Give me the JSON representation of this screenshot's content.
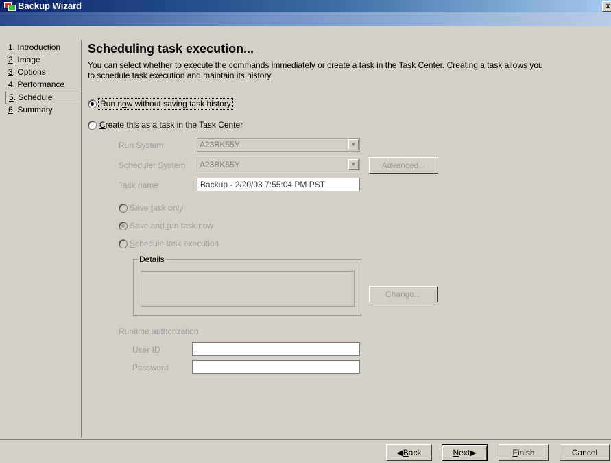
{
  "window": {
    "title": "Backup Wizard",
    "close_glyph": "x"
  },
  "nav": {
    "items": [
      {
        "num": "1",
        "rest": ". Introduction"
      },
      {
        "num": "2",
        "rest": ". Image"
      },
      {
        "num": "3",
        "rest": ". Options"
      },
      {
        "num": "4",
        "rest": ". Performance"
      },
      {
        "num": "5",
        "rest": ". Schedule"
      },
      {
        "num": "6",
        "rest": ". Summary"
      }
    ]
  },
  "page": {
    "heading": "Scheduling task execution...",
    "desc_line1": "You can select whether to execute the commands immediately or create a task in the Task Center. Creating a task allows you",
    "desc_line2": "to schedule task execution and maintain its history."
  },
  "options": {
    "run_now_prefix": "Run n",
    "run_now_accel": "o",
    "run_now_suffix": "w without saving task history",
    "create_accel": "C",
    "create_suffix": "reate this as a task in the Task Center"
  },
  "form": {
    "run_system_label": "Run System",
    "run_system_value": "A23BK55Y",
    "scheduler_system_label": "Scheduler System",
    "scheduler_system_value": "A23BK55Y",
    "advanced_accel": "A",
    "advanced_suffix": "dvanced...",
    "task_name_label": "Task name",
    "task_name_value": "Backup - 2/20/03 7:55:04 PM PST",
    "save_only_prefix": "Save ",
    "save_only_accel": "t",
    "save_only_suffix": "ask only",
    "save_run_prefix": "Save and ",
    "save_run_accel": "r",
    "save_run_suffix": "un task now",
    "schedule_accel": "S",
    "schedule_suffix": "chedule task execution",
    "details_label": "Details",
    "change_label": "Change...",
    "runtime_auth_label": "Runtime authorization",
    "user_id_label": "User ID",
    "user_id_value": "",
    "password_label": "Password",
    "password_value": ""
  },
  "footer": {
    "back_accel": "B",
    "back_suffix": "ack",
    "next_accel": "N",
    "next_suffix": "ext",
    "finish_accel": "F",
    "finish_suffix": "inish",
    "cancel_label": "Cancel"
  },
  "colors": {
    "title_gradient_start": "#0a246a",
    "face": "#d4d0c8",
    "disabled_text": "#a0a0a0"
  },
  "icons": {
    "app": "backup-wizard-icon",
    "close": "close-icon",
    "combo_arrow": "chevron-down-icon",
    "back": "left-triangle-icon",
    "next": "right-triangle-icon"
  }
}
